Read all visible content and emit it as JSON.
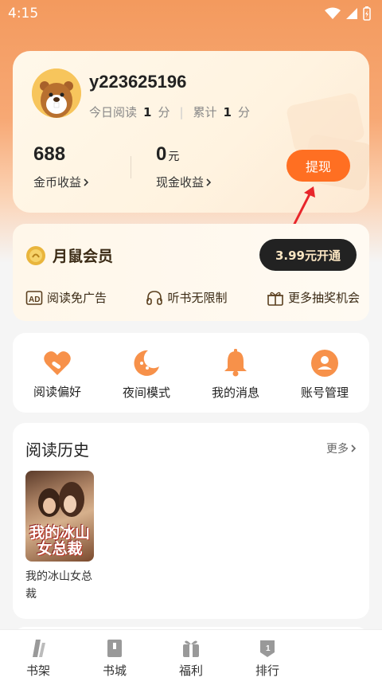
{
  "status_bar": {
    "time": "4:15"
  },
  "profile": {
    "username": "y223625196",
    "today_read_label": "今日阅读",
    "today_read_value": "1",
    "today_read_unit": "分",
    "total_label": "累计",
    "total_value": "1",
    "total_unit": "分",
    "coins_value": "688",
    "coins_label": "金币收益",
    "cash_value": "0",
    "cash_unit": "元",
    "cash_label": "现金收益",
    "withdraw_label": "提现"
  },
  "vip": {
    "title": "月鼠会员",
    "button_label": "3.99元开通",
    "perks": [
      {
        "label": "阅读免广告",
        "icon": "ad-free-icon"
      },
      {
        "label": "听书无限制",
        "icon": "headphones-icon"
      },
      {
        "label": "更多抽奖机会",
        "icon": "gift-icon"
      }
    ]
  },
  "tools": [
    {
      "label": "阅读偏好",
      "icon": "heart-icon"
    },
    {
      "label": "夜间模式",
      "icon": "moon-icon"
    },
    {
      "label": "我的消息",
      "icon": "bell-icon"
    },
    {
      "label": "账号管理",
      "icon": "user-icon"
    }
  ],
  "history": {
    "title": "阅读历史",
    "more_label": "更多",
    "books": [
      {
        "title": "我的冰山女总裁",
        "cover_text": "我的冰山女总裁"
      }
    ]
  },
  "bottom_nav": [
    {
      "label": "书架",
      "icon": "bookshelf-icon"
    },
    {
      "label": "书城",
      "icon": "bookstore-icon"
    },
    {
      "label": "福利",
      "icon": "gift-box-icon"
    },
    {
      "label": "排行",
      "icon": "ranking-icon"
    }
  ],
  "colors": {
    "accent": "#ff6f22",
    "header_gradient_top": "#f39a5e",
    "vip_button_bg": "#222222",
    "tool_icon": "#f7914a"
  }
}
